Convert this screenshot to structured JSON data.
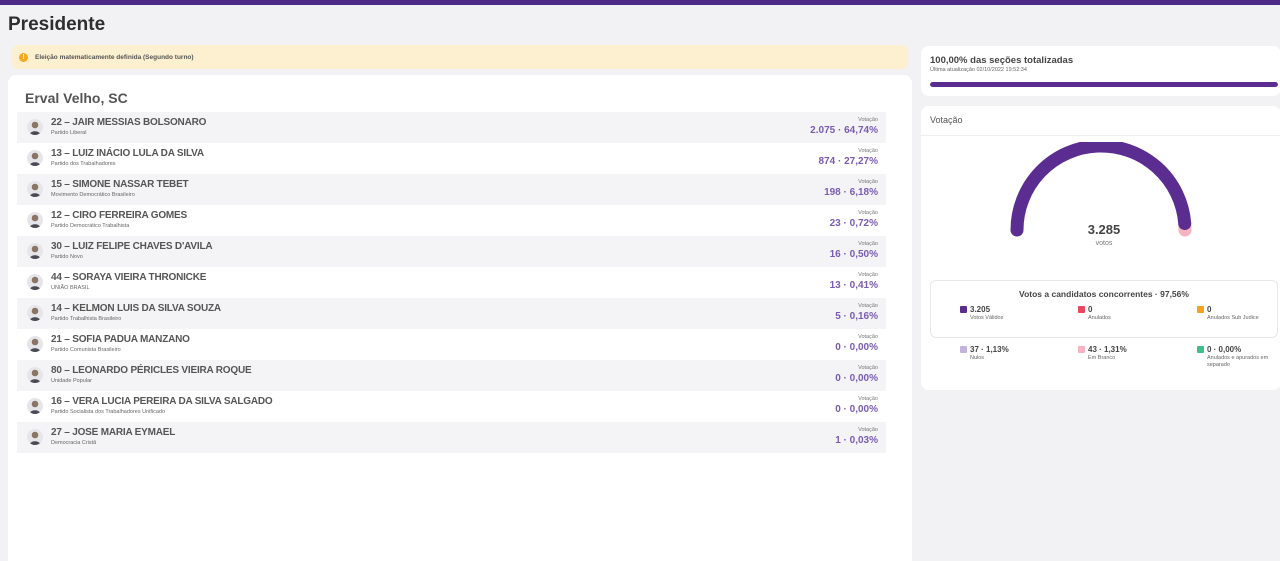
{
  "page_title": "Presidente",
  "notice": {
    "text": "Eleição matematicamente definida (Segundo turno)",
    "icon": "alert-icon",
    "color": "#f4a91f"
  },
  "location": "Erval Velho, SC",
  "vote_label": "Votação",
  "candidates": [
    {
      "name": "22 – JAIR MESSIAS BOLSONARO",
      "party": "Partido Liberal",
      "votes": "2.075 · 64,74%"
    },
    {
      "name": "13 – LUIZ INÁCIO LULA DA SILVA",
      "party": "Partido dos Trabalhadores",
      "votes": "874 · 27,27%"
    },
    {
      "name": "15 – SIMONE NASSAR TEBET",
      "party": "Movimento Democrático Brasileiro",
      "votes": "198 · 6,18%"
    },
    {
      "name": "12 – CIRO FERREIRA GOMES",
      "party": "Partido Democrático Trabalhista",
      "votes": "23 · 0,72%"
    },
    {
      "name": "30 – LUIZ FELIPE CHAVES D'AVILA",
      "party": "Partido Novo",
      "votes": "16 · 0,50%"
    },
    {
      "name": "44 – SORAYA VIEIRA THRONICKE",
      "party": "UNIÃO BRASIL",
      "votes": "13 · 0,41%"
    },
    {
      "name": "14 – KELMON LUIS DA SILVA SOUZA",
      "party": "Partido Trabalhista Brasileiro",
      "votes": "5 · 0,16%"
    },
    {
      "name": "21 – SOFIA PADUA MANZANO",
      "party": "Partido Comunista Brasileiro",
      "votes": "0 · 0,00%"
    },
    {
      "name": "80 – LEONARDO PÉRICLES VIEIRA ROQUE",
      "party": "Unidade Popular",
      "votes": "0 · 0,00%"
    },
    {
      "name": "16 – VERA LUCIA PEREIRA DA SILVA SALGADO",
      "party": "Partido Socialista dos Trabalhadores Unificado",
      "votes": "0 · 0,00%"
    },
    {
      "name": "27 – JOSE MARIA EYMAEL",
      "party": "Democracia Cristã",
      "votes": "1 · 0,03%"
    }
  ],
  "sections": {
    "title": "100,00% das seções totalizadas",
    "updated": "Última atualização 02/10/2022 19:52:34",
    "progress": 1.0
  },
  "voting": {
    "title": "Votação",
    "total": "3.285",
    "unit": "votos",
    "gauge_fraction": 0.9756,
    "breakdown_title": "Votos a candidatos concorrentes · 97,56%",
    "stats": [
      {
        "value": "3.205",
        "label": "Votos Válidos",
        "color": "#5c2d91"
      },
      {
        "value": "0",
        "label": "Anulados",
        "color": "#e8475e"
      },
      {
        "value": "0",
        "label": "Anulados Sub Judice",
        "color": "#f4a21f"
      },
      {
        "value": "37 · 1,13%",
        "label": "Nulos",
        "color": "#c3b3dc"
      },
      {
        "value": "43 · 1,31%",
        "label": "Em Branco",
        "color": "#f7b3c0"
      },
      {
        "value": "0 · 0,00%",
        "label": "Anulados e apurados em separado",
        "color": "#3fbf8a"
      }
    ]
  },
  "colors": {
    "brand": "#4c2a85",
    "gauge": "#5c2d91",
    "gauge_rest": "#f7b3c0",
    "votes_text": "#7a5bb3"
  }
}
